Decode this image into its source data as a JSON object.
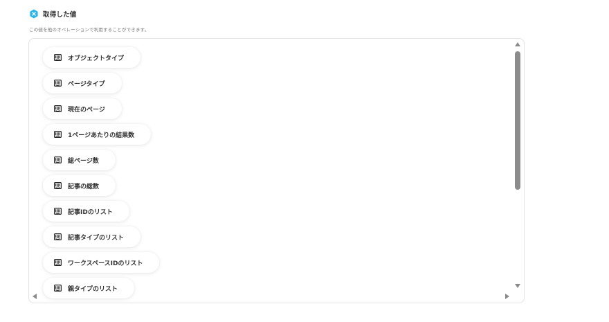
{
  "section": {
    "title": "取得した値",
    "description": "この値を他のオペレーションで利用することができます。",
    "accent_color": "#29b6e6"
  },
  "values": {
    "icon": "intercom-icon",
    "items": [
      {
        "label": "オブジェクトタイプ"
      },
      {
        "label": "ページタイプ"
      },
      {
        "label": "現在のページ"
      },
      {
        "label": "1ページあたりの結果数"
      },
      {
        "label": "総ページ数"
      },
      {
        "label": "記事の総数"
      },
      {
        "label": "記事IDのリスト"
      },
      {
        "label": "記事タイプのリスト"
      },
      {
        "label": "ワークスペースIDのリスト"
      },
      {
        "label": "親タイプのリスト"
      }
    ]
  }
}
